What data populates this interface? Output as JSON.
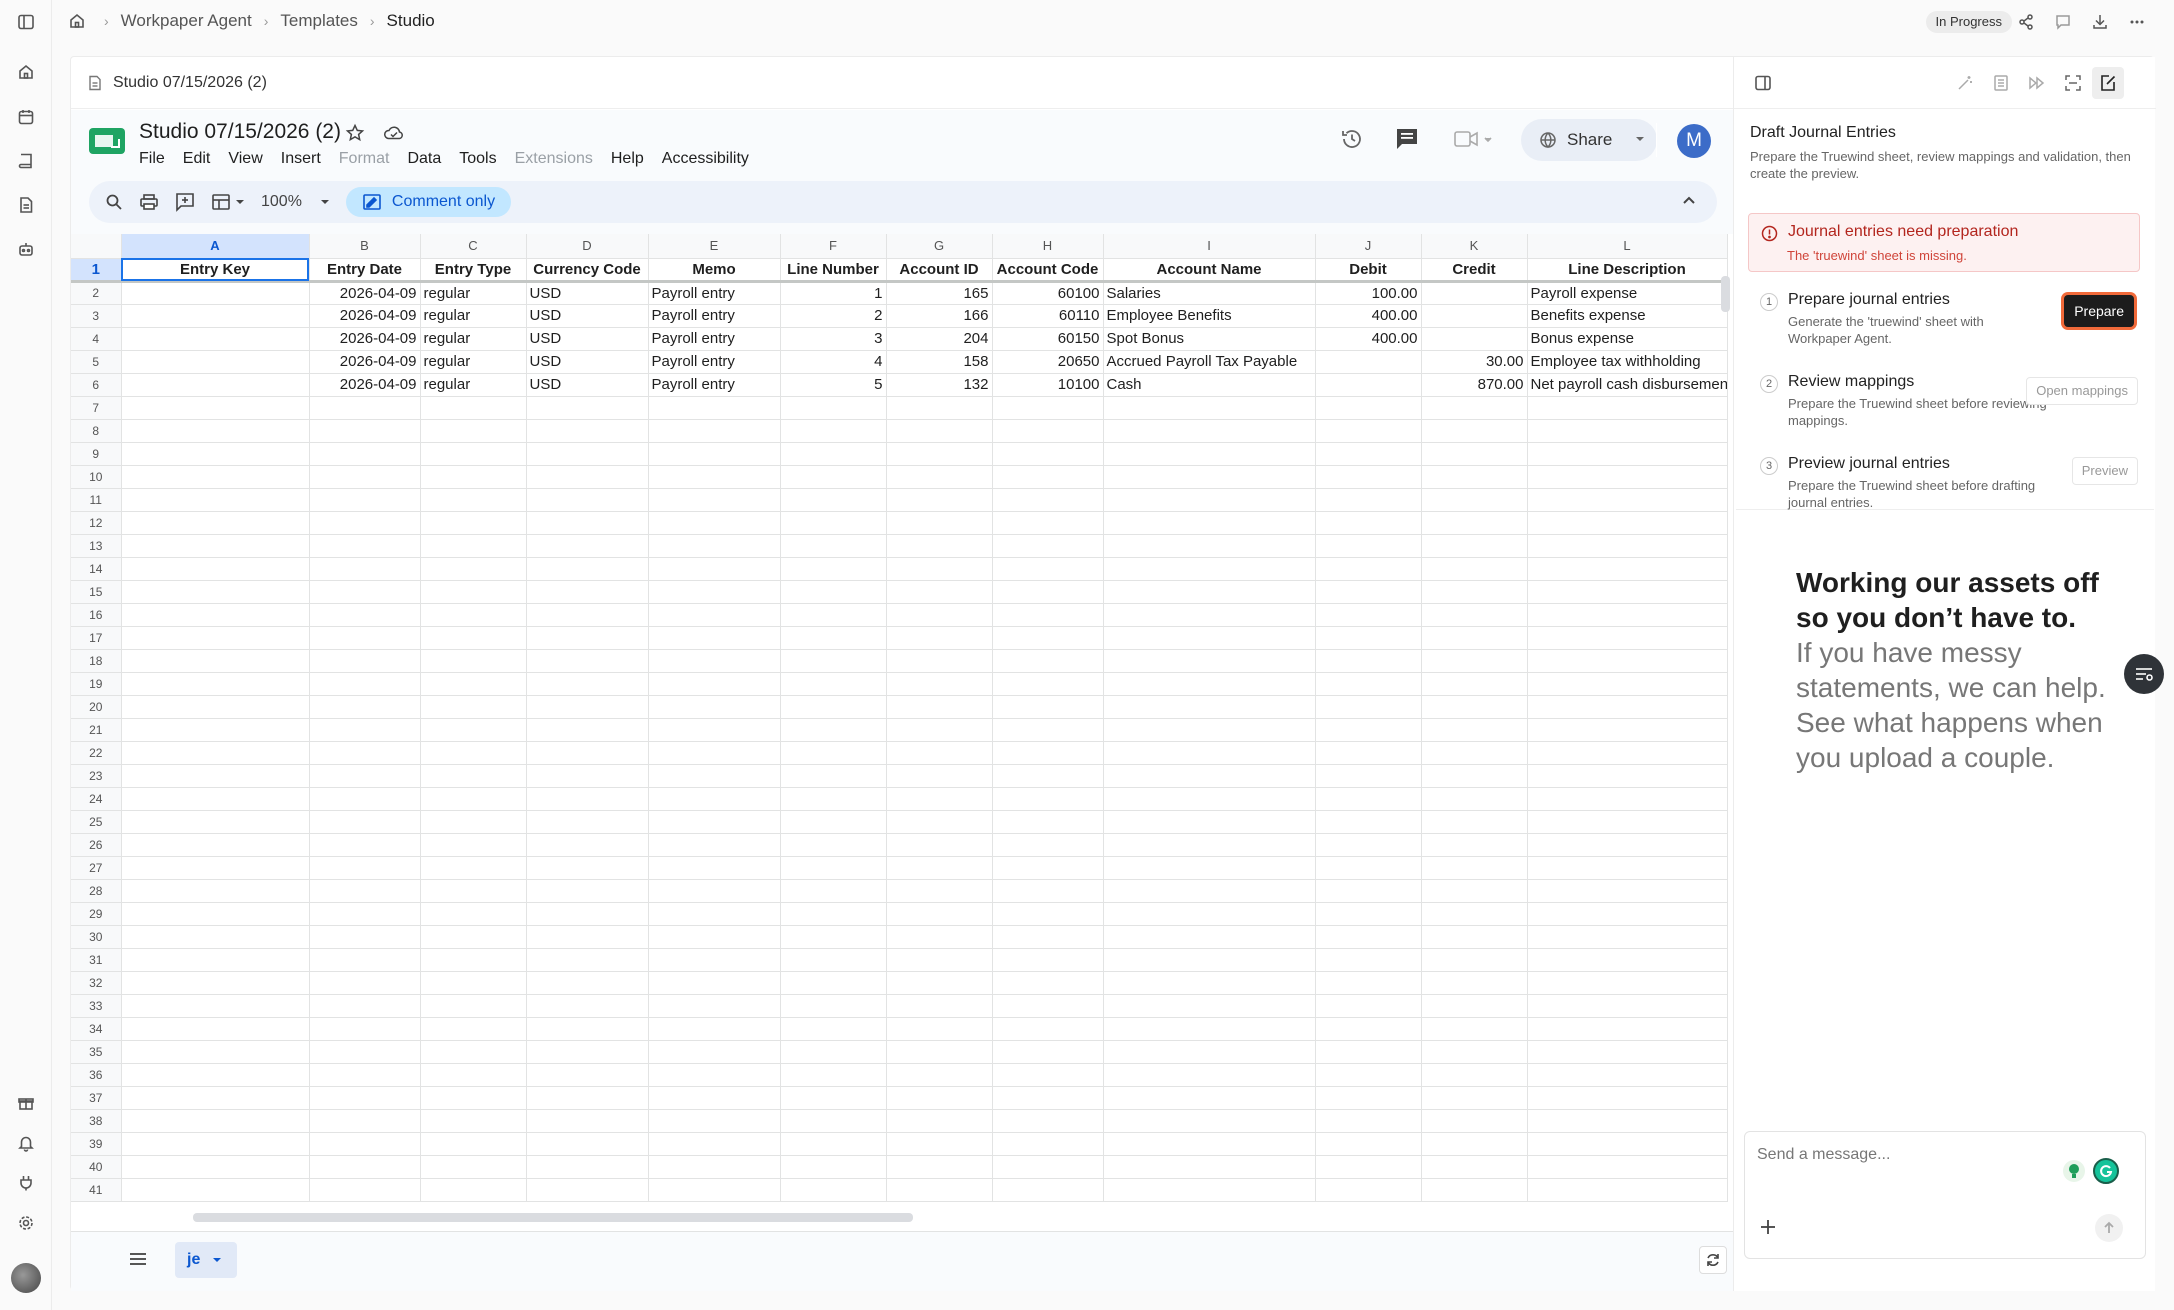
{
  "breadcrumb": {
    "items": [
      "Workpaper Agent",
      "Templates",
      "Studio"
    ]
  },
  "status_badge": "In Progress",
  "doc_tab_title": "Studio 07/15/2026 (2)",
  "sheets": {
    "title": "Studio 07/15/2026 (2)",
    "menu": [
      "File",
      "Edit",
      "View",
      "Insert",
      "Format",
      "Data",
      "Tools",
      "Extensions",
      "Help",
      "Accessibility"
    ],
    "disabled_menu": [
      "Format",
      "Extensions"
    ],
    "zoom": "100%",
    "comment_only_label": "Comment only",
    "share_label": "Share",
    "avatar_letter": "M",
    "columns": [
      "A",
      "B",
      "C",
      "D",
      "E",
      "F",
      "G",
      "H",
      "I",
      "J",
      "K",
      "L"
    ],
    "selected_cell": "A1",
    "headers": [
      "Entry Key",
      "Entry Date",
      "Entry Type",
      "Currency Code",
      "Memo",
      "Line Number",
      "Account ID",
      "Account Code",
      "Account Name",
      "Debit",
      "Credit",
      "Line Description"
    ],
    "rows": [
      [
        "",
        "2026-04-09",
        "regular",
        "USD",
        "Payroll entry",
        "1",
        "165",
        "60100",
        "Salaries",
        "100.00",
        "",
        "Payroll expense"
      ],
      [
        "",
        "2026-04-09",
        "regular",
        "USD",
        "Payroll entry",
        "2",
        "166",
        "60110",
        "Employee Benefits",
        "400.00",
        "",
        "Benefits expense"
      ],
      [
        "",
        "2026-04-09",
        "regular",
        "USD",
        "Payroll entry",
        "3",
        "204",
        "60150",
        "Spot Bonus",
        "400.00",
        "",
        "Bonus expense"
      ],
      [
        "",
        "2026-04-09",
        "regular",
        "USD",
        "Payroll entry",
        "4",
        "158",
        "20650",
        "Accrued Payroll Tax Payable",
        "",
        "30.00",
        "Employee tax withholding"
      ],
      [
        "",
        "2026-04-09",
        "regular",
        "USD",
        "Payroll entry",
        "5",
        "132",
        "10100",
        "Cash",
        "",
        "870.00",
        "Net payroll cash disbursemen"
      ]
    ],
    "row_count": 41,
    "sheet_tab": "je"
  },
  "panel": {
    "title": "Draft Journal Entries",
    "description": "Prepare the Truewind sheet, review mappings and validation, then create the preview.",
    "alert_title": "Journal entries need preparation",
    "alert_message": "The 'truewind' sheet is missing.",
    "steps": [
      {
        "num": "1",
        "title": "Prepare journal entries",
        "desc": "Generate the 'truewind' sheet with Workpaper Agent.",
        "button": "Prepare"
      },
      {
        "num": "2",
        "title": "Review mappings",
        "desc": "Prepare the Truewind sheet before reviewing mappings.",
        "button": "Open mappings"
      },
      {
        "num": "3",
        "title": "Preview journal entries",
        "desc": "Prepare the Truewind sheet before drafting journal entries.",
        "button": "Preview"
      }
    ],
    "promo_bold": "Working our assets off so you don’t have to.",
    "promo_text": "If you have messy statements, we can help. See what happens when you upload a couple.",
    "message_placeholder": "Send a message..."
  },
  "colors": {
    "accent": "#0b57d0",
    "alert": "#b3261e",
    "prepare_outline": "#f16a3a"
  }
}
